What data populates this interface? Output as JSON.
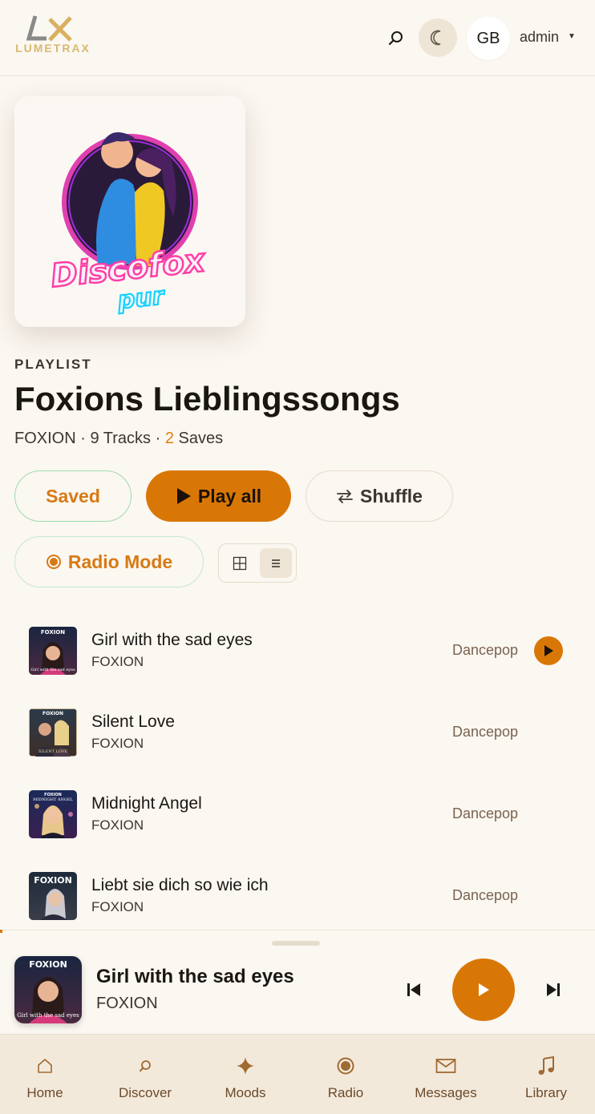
{
  "header": {
    "logo_text": "LUMETRAX",
    "avatar_initials": "GB",
    "username": "admin",
    "icons": {
      "search": "search-icon",
      "theme": "moon-icon",
      "caret": "caret-down-icon"
    }
  },
  "playlist": {
    "eyebrow": "PLAYLIST",
    "title": "Foxions Lieblingssongs",
    "cover_text_1": "Discofox",
    "cover_text_2": "pur",
    "owner": "FOXION",
    "tracks_text": "9 Tracks",
    "saves_count": "2",
    "saves_label": "Saves"
  },
  "actions": {
    "saved": "Saved",
    "play_all": "Play all",
    "shuffle": "Shuffle",
    "radio_mode": "Radio Mode",
    "view_grid_icon": "grid-icon",
    "view_list_icon": "list-icon"
  },
  "tracks": [
    {
      "title": "Girl with the sad eyes",
      "artist": "FOXION",
      "genre": "Dancepop",
      "thumb_text": "FOXION",
      "thumb_sub": "Girl with the sad eyes"
    },
    {
      "title": "Silent Love",
      "artist": "FOXION",
      "genre": "Dancepop",
      "thumb_text": "FOXION",
      "thumb_sub": "SILENT LOVE"
    },
    {
      "title": "Midnight Angel",
      "artist": "FOXION",
      "genre": "Dancepop",
      "thumb_text": "FOXION",
      "thumb_sub": "MIDNIGHT ANGEL"
    },
    {
      "title": "Liebt sie dich so wie ich",
      "artist": "FOXION",
      "genre": "Dancepop",
      "thumb_text": "FOXION",
      "thumb_sub": ""
    }
  ],
  "now_playing": {
    "title": "Girl with the sad eyes",
    "artist": "FOXION",
    "cover_text": "FOXION",
    "cover_sub": "Girl with the sad eyes",
    "progress": 0.004
  },
  "nav": [
    {
      "label": "Home",
      "icon": "home-icon"
    },
    {
      "label": "Discover",
      "icon": "search-icon"
    },
    {
      "label": "Moods",
      "icon": "sparkle-icon"
    },
    {
      "label": "Radio",
      "icon": "radio-icon"
    },
    {
      "label": "Messages",
      "icon": "mail-icon"
    },
    {
      "label": "Library",
      "icon": "music-note-icon"
    }
  ],
  "colors": {
    "accent": "#d97706",
    "background": "#fbf7f1",
    "nav_bg": "#f3e9db"
  }
}
